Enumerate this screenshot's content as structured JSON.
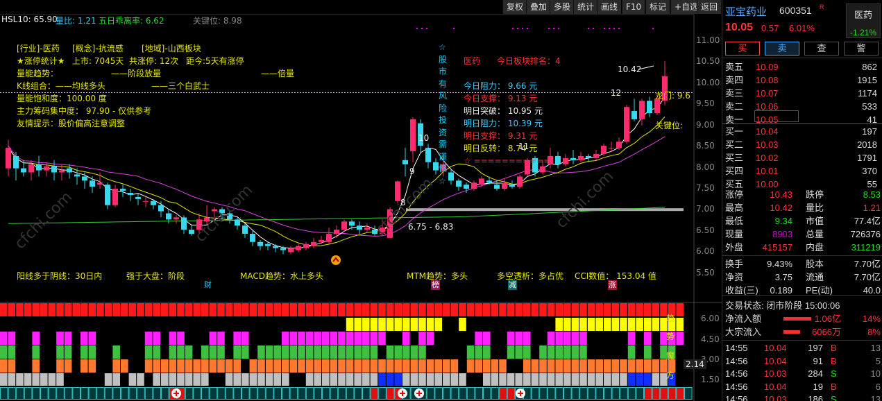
{
  "toolbar": [
    "复权",
    "叠加",
    "多股",
    "统计",
    "画线",
    "F10",
    "标记",
    "+自选",
    "返回"
  ],
  "header": {
    "hsl": "HSL10: 65.90",
    "lb": "量比: 1.21",
    "wr": "五日乖离率: 6.62",
    "gj": "关键位: 8.98"
  },
  "info": {
    "l1a": "[行业]-医药",
    "l1b": "[概念]-抗流感",
    "l1c": "[地域]-山西板块",
    "l2a": "★涨停统计★",
    "l2b": "上市: 7045天",
    "l2c": "共涨停: 12次",
    "l2d": "距今:5天有涨停",
    "l3a": "量能趋势：",
    "l3b": "——阶段放量",
    "l3c": "——倍量",
    "l4a": "K线组合：——均线多头",
    "l4b": "——三个白武士",
    "l5": "量能饱和度：100.00 度",
    "l6": "主力筹码集中度： 97.90 - 仅供参考",
    "l7": "友情提示：股价偏高注意调整"
  },
  "vertical_text": "☆股市有风险投资需谨慎☆",
  "sector": {
    "name": "医药",
    "rank_label": "今日板块排名：4"
  },
  "levels": {
    "l1": "今日阻力： 9.66 元",
    "l2": "今日支撑： 9.13 元",
    "l3": "明日突破： 10.95 元",
    "l4": "明日阻力： 10.39 元",
    "l5": "明日支撑： 9.31 元",
    "l6": "明日反转： 8.74 元",
    "l7": "☆ ==========="
  },
  "annot": {
    "longmen": "龙门: 9.6",
    "guanjian": "关键位:",
    "high": "10.42",
    "n12": "12",
    "n10": "10",
    "n9": "9",
    "n8": "8",
    "n11": "11",
    "range": "6.75 - 6.83"
  },
  "bottom": {
    "a": "阳线多于阴线：30日内",
    "b": "强于大盘：阶段",
    "c": "MACD趋势：水上多头",
    "d": "MTM趋势：多头",
    "e": "多空透析：多占优",
    "f": "CCI数值： 153.04 值"
  },
  "tags": {
    "cai": "财",
    "bang": "榜",
    "jian": "减",
    "zhang": "涨"
  },
  "yaxis": [
    "11.00",
    "10.50",
    "10.00",
    "9.50",
    "9.00",
    "8.50",
    "8.00",
    "7.50",
    "7.00",
    "6.50",
    "6.00",
    "5.50"
  ],
  "lower": {
    "ticks": [
      "6.00",
      "4.50",
      "3.00",
      "1.50"
    ],
    "value": "2.14",
    "label": [
      "趋",
      "势",
      "魔",
      "方"
    ]
  },
  "stock": {
    "name": "亚宝药业",
    "code": "600351",
    "flag": "R",
    "sector": "医药",
    "sector_chg": "-1.21%",
    "price": "10.05",
    "chg": "0.57",
    "pct": "6.01%"
  },
  "buttons": [
    "买",
    "卖",
    "查",
    "警"
  ],
  "asks": [
    [
      "卖五",
      "10.09",
      "862"
    ],
    [
      "卖四",
      "10.08",
      "1915"
    ],
    [
      "卖三",
      "10.07",
      "1174"
    ],
    [
      "卖二",
      "10.06",
      "533"
    ],
    [
      "卖一",
      "10.05",
      "41"
    ]
  ],
  "bids": [
    [
      "买一",
      "10.04",
      "197"
    ],
    [
      "买二",
      "10.03",
      "2018"
    ],
    [
      "买三",
      "10.02",
      "1791"
    ],
    [
      "买四",
      "10.01",
      "370"
    ],
    [
      "买五",
      "10.00",
      "55"
    ]
  ],
  "stats": [
    [
      "涨停",
      "10.43",
      "跌停",
      "8.53"
    ],
    [
      "最高",
      "10.42",
      "量比",
      "1.21"
    ],
    [
      "最低",
      "9.34",
      "市值",
      "77.4亿"
    ],
    [
      "现量",
      "8903",
      "总量",
      "726376"
    ],
    [
      "外盘",
      "415157",
      "内盘",
      "311219"
    ],
    [
      "换手",
      "9.43%",
      "股本",
      "7.70亿"
    ],
    [
      "净资",
      "3.75",
      "流通",
      "7.70亿"
    ],
    [
      "收益(三)",
      "0.189",
      "PE(动)",
      "40.0"
    ]
  ],
  "status": "交易状态: 闭市阶段 15:00:06",
  "flows": [
    [
      "净流入额",
      "1.06亿",
      "14%"
    ],
    [
      "大宗流入",
      "6066万",
      "8%"
    ]
  ],
  "ticks": [
    [
      "14:55",
      "10.04",
      "197",
      "B",
      "13"
    ],
    [
      "14:56",
      "10.04",
      "91",
      "B",
      "5"
    ],
    [
      "14:56",
      "10.03",
      "284",
      "S",
      "10"
    ],
    [
      "14:56",
      "10.04",
      "19",
      "B",
      "6"
    ],
    [
      "14:56",
      "10.03",
      "186",
      "S",
      "13"
    ]
  ],
  "colors": {
    "up": "#ff2b6e",
    "down": "#38d8f0",
    "ma5": "#ffffff",
    "ma10": "#e6e600",
    "ma20": "#e040e0",
    "ma60": "#30d030"
  },
  "chart_data": {
    "type": "candlestick",
    "ylim": [
      5.25,
      11.1
    ],
    "candles": [
      [
        7.8,
        8.3,
        8.5,
        7.6
      ],
      [
        8.1,
        7.8,
        8.2,
        7.5
      ],
      [
        7.8,
        7.7,
        8.0,
        7.6
      ],
      [
        7.7,
        7.9,
        8.0,
        7.5
      ],
      [
        7.9,
        7.75,
        8.1,
        7.6
      ],
      [
        7.75,
        7.85,
        7.95,
        7.6
      ],
      [
        7.85,
        7.7,
        8.0,
        7.5
      ],
      [
        7.7,
        7.75,
        7.9,
        7.5
      ],
      [
        7.8,
        7.7,
        7.9,
        7.55
      ],
      [
        7.65,
        7.6,
        7.8,
        7.4
      ],
      [
        7.6,
        7.5,
        7.7,
        7.3
      ],
      [
        7.5,
        7.35,
        7.6,
        7.2
      ],
      [
        7.4,
        7.45,
        7.7,
        7.3
      ],
      [
        7.4,
        6.9,
        7.45,
        6.8
      ],
      [
        6.9,
        7.3,
        7.4,
        6.85
      ],
      [
        7.3,
        7.25,
        7.4,
        7.1
      ],
      [
        7.2,
        7.15,
        7.3,
        7.0
      ],
      [
        7.1,
        7.05,
        7.2,
        6.9
      ],
      [
        7.0,
        7.0,
        7.1,
        6.85
      ],
      [
        7.0,
        6.9,
        7.05,
        6.8
      ],
      [
        6.9,
        6.75,
        7.0,
        6.6
      ],
      [
        6.7,
        6.55,
        6.8,
        6.45
      ],
      [
        6.55,
        6.6,
        6.65,
        6.45
      ],
      [
        6.6,
        6.3,
        6.65,
        6.2
      ],
      [
        6.3,
        6.2,
        6.4,
        6.15
      ],
      [
        6.3,
        6.55,
        6.7,
        6.2
      ],
      [
        6.5,
        6.6,
        6.9,
        6.4
      ],
      [
        6.75,
        6.8,
        6.85,
        6.6
      ],
      [
        6.8,
        6.7,
        6.85,
        6.55
      ],
      [
        6.7,
        6.55,
        6.75,
        6.45
      ],
      [
        6.55,
        6.4,
        6.6,
        6.3
      ],
      [
        6.4,
        6.2,
        6.45,
        6.1
      ],
      [
        6.2,
        6.0,
        6.3,
        5.9
      ],
      [
        6.0,
        5.9,
        6.05,
        5.8
      ],
      [
        5.95,
        5.9,
        6.0,
        5.8
      ],
      [
        5.9,
        5.85,
        5.95,
        5.75
      ],
      [
        5.85,
        5.8,
        5.9,
        5.7
      ],
      [
        5.75,
        5.85,
        5.9,
        5.7
      ],
      [
        5.8,
        5.9,
        5.95,
        5.75
      ],
      [
        5.85,
        5.95,
        6.0,
        5.8
      ],
      [
        5.9,
        6.0,
        6.1,
        5.85
      ],
      [
        6.0,
        6.05,
        6.15,
        5.95
      ],
      [
        6.0,
        6.2,
        6.35,
        5.95
      ],
      [
        6.2,
        6.3,
        6.4,
        6.1
      ],
      [
        6.3,
        6.5,
        6.55,
        6.25
      ],
      [
        6.5,
        6.4,
        6.55,
        6.3
      ],
      [
        6.4,
        6.3,
        6.5,
        6.2
      ],
      [
        6.3,
        6.35,
        6.45,
        6.25
      ],
      [
        6.3,
        6.2,
        6.4,
        6.15
      ],
      [
        6.2,
        6.35,
        6.45,
        6.15
      ],
      [
        6.1,
        6.8,
        6.85,
        6.1
      ],
      [
        7.0,
        7.48,
        7.5,
        6.95
      ],
      [
        8.0,
        7.9,
        8.3,
        7.6
      ],
      [
        8.22,
        9.0,
        9.05,
        7.95
      ],
      [
        8.9,
        8.35,
        9.0,
        8.2
      ],
      [
        8.3,
        7.95,
        8.4,
        7.8
      ],
      [
        7.95,
        7.75,
        8.05,
        7.65
      ],
      [
        7.75,
        7.9,
        8.0,
        7.6
      ],
      [
        7.7,
        7.5,
        7.8,
        7.4
      ],
      [
        7.5,
        7.35,
        7.55,
        7.25
      ],
      [
        7.4,
        7.3,
        7.45,
        7.2
      ],
      [
        7.3,
        7.45,
        7.5,
        7.25
      ],
      [
        7.4,
        7.55,
        7.6,
        7.35
      ],
      [
        7.5,
        7.45,
        7.6,
        7.4
      ],
      [
        7.4,
        7.3,
        7.5,
        7.25
      ],
      [
        7.3,
        7.45,
        7.55,
        7.25
      ],
      [
        7.4,
        7.35,
        7.5,
        7.3
      ],
      [
        7.35,
        7.6,
        7.65,
        7.3
      ],
      [
        7.65,
        8.0,
        8.05,
        7.6
      ],
      [
        8.05,
        7.7,
        8.1,
        7.6
      ],
      [
        7.7,
        7.85,
        8.0,
        7.65
      ],
      [
        7.9,
        8.1,
        8.3,
        7.8
      ],
      [
        8.1,
        7.9,
        8.2,
        7.8
      ],
      [
        7.9,
        8.05,
        8.15,
        7.85
      ],
      [
        8.05,
        8.0,
        8.25,
        7.9
      ],
      [
        8.0,
        8.1,
        8.2,
        7.95
      ],
      [
        8.1,
        8.05,
        8.15,
        7.95
      ],
      [
        8.05,
        8.15,
        8.25,
        8.0
      ],
      [
        8.15,
        8.35,
        8.4,
        8.1
      ],
      [
        8.3,
        8.3,
        8.45,
        8.2
      ],
      [
        8.3,
        8.45,
        8.55,
        8.25
      ],
      [
        8.45,
        9.3,
        9.35,
        8.4
      ],
      [
        9.2,
        9.0,
        9.5,
        8.95
      ],
      [
        9.0,
        9.45,
        9.5,
        8.85
      ],
      [
        9.45,
        9.15,
        9.55,
        9.05
      ],
      [
        9.15,
        9.5,
        9.6,
        9.1
      ],
      [
        9.45,
        10.05,
        10.42,
        9.34
      ]
    ]
  },
  "lower_grid": {
    "r1": "RRRRRRRRRRRRRRRRRRRRRRRRRRRRRRRRRRRRRRRRRRRRRRRRRRRRRRRRRRRRRRRRRRRRRRRRRRRRRRRRRRRRR",
    "r2": "...........................................YYYYYYYYYYYY..Y...........YYYYYYYYYYYYYYYY",
    "r3": "MM..M..MM.MM......MM.MM...MM.MM....MMMMMMMMMMMMM..M.MM.....MM..MMM..MMMMM.....M.M.MMM",
    "r4": "GG..G..GG.GG..G...GG.GGG.GGG.GG.GGGGGGGGGGGGGGG.GGGGG.....GGG..GGG.GGGGGG.....G.G.GG",
    "r5": "OO..O..OO.OO..OO..OOOOOOOOOOOO.OOOOOOOOOOOOOOOOOOOOOOOOOO.OOOOO..OOOOOOOOOOOOOOOOOOO",
    "r6": "AAAAAAAA.....AA.AA.AAAAAAA..AAAAAAAA..AAAAAAAAABBBAAAAAAAA..AAAAAAAAAAAAAAAAAABBBAAB",
    "r7": "TTTTTTTTTTTTTTTTTTTTTRRTTTTTTTTTTTTTTTTTTTTTTTRTRRTTTTTTTTTTTTRRTTTTTTTTTTTTTTTTRRRRRT"
  }
}
